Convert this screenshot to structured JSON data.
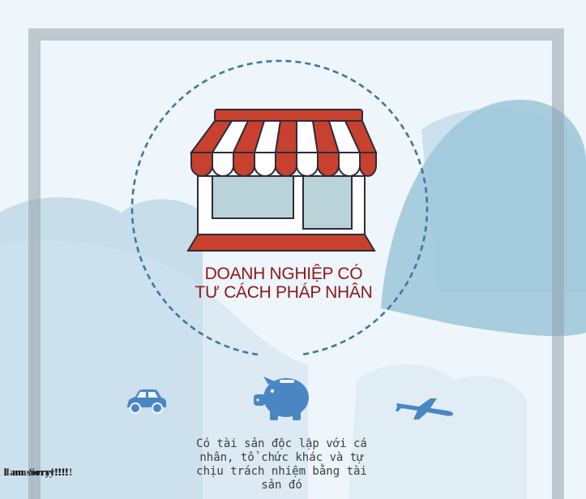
{
  "title": {
    "line1": "DOANH NGHIỆP CÓ",
    "line2": "TƯ CÁCH PHÁP NHÂN"
  },
  "description": {
    "line1": "Có tài sản độc lập với cá",
    "line2": "nhân, tổ chức khác và tự",
    "line3": "chịu trách nhiệm bằng tài",
    "line4": "sản đó"
  },
  "overlay": {
    "text_a": "I am sorry!!!!!",
    "text_b": "I am Sorry!!!!!"
  },
  "icons": [
    "shop-icon",
    "car-icon",
    "piggy-bank-icon",
    "airplane-icon"
  ],
  "colors": {
    "background": "#eef5fb",
    "cloud": "#b9d6e4",
    "frame": "#9ea9b2",
    "awning_red": "#c8412e",
    "awning_white": "#ffffff",
    "title": "#8a1a1a",
    "dashed_circle": "#3f77a0",
    "icon_blue": "#4a86c4"
  }
}
